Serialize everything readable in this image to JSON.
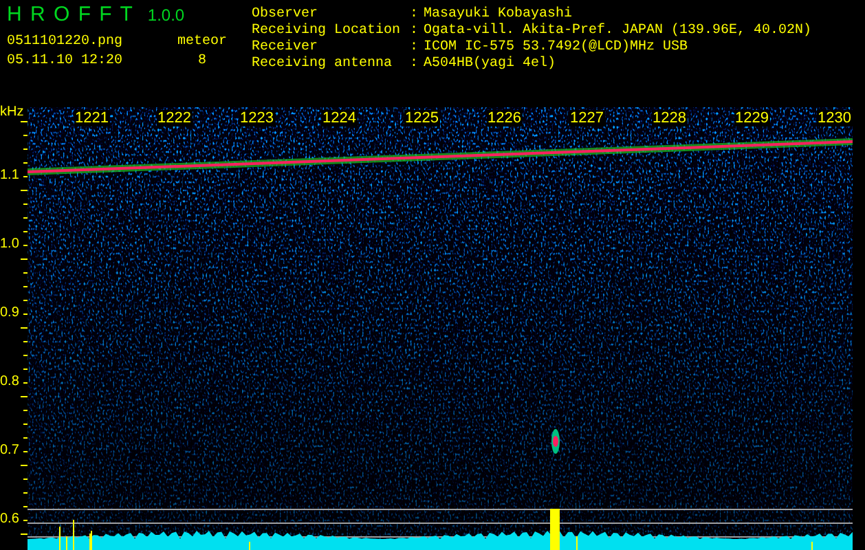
{
  "header": {
    "app_title": "H R O F F T",
    "version": "1.0.0",
    "file_name": "0511101220.png",
    "date_time": "05.11.10 12:20",
    "meteor_label": "meteor",
    "meteor_count": "8"
  },
  "info": [
    {
      "label": "Observer",
      "separator": ":",
      "value": "Masayuki Kobayashi"
    },
    {
      "label": "Receiving Location",
      "separator": ":",
      "value": "Ogata-vill. Akita-Pref. JAPAN (139.96E, 40.02N)"
    },
    {
      "label": "Receiver",
      "separator": ":",
      "value": "ICOM IC-575 53.7492(@LCD)MHz USB"
    },
    {
      "label": "Receiving antenna",
      "separator": ":",
      "value": "A504HB(yagi 4el)"
    }
  ],
  "frequency_axis": {
    "unit": "kHz",
    "ticks": [
      "1.1",
      "1.0",
      "0.9",
      "0.8",
      "0.7",
      "0.6"
    ]
  },
  "time_labels": [
    "1221",
    "1222",
    "1223",
    "1224",
    "1225",
    "1226",
    "1227",
    "1228",
    "1229",
    "1230"
  ]
}
